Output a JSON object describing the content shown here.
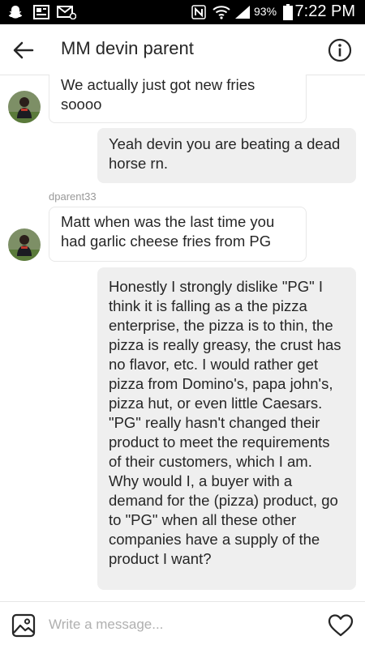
{
  "status_bar": {
    "battery": "93%",
    "time": "7:22 PM"
  },
  "header": {
    "title": "MM devin parent"
  },
  "messages": [
    {
      "direction": "incoming",
      "text": "We actually just got new fries soooo"
    },
    {
      "direction": "outgoing",
      "text": "Yeah devin you are beating a dead horse rn."
    },
    {
      "direction": "incoming",
      "sender": "dparent33",
      "text": "Matt when was the last time you had garlic cheese fries from PG"
    },
    {
      "direction": "outgoing",
      "text": "Honestly I strongly dislike \"PG\" I think it is falling as a the pizza enterprise, the pizza is to thin, the pizza is really greasy, the crust has no flavor, etc. I would rather get pizza from Domino's, papa john's, pizza hut, or even little Caesars. \"PG\" really hasn't changed their product to meet the requirements of their customers, which I am. Why would I, a buyer with a demand for the (pizza) product, go to \"PG\" when all these other companies have a supply of the product I want?"
    }
  ],
  "composer": {
    "placeholder": "Write a message..."
  },
  "icons": {
    "back": "arrow-left-icon",
    "info": "info-circle-icon",
    "gallery": "image-gallery-icon",
    "like": "heart-icon"
  }
}
